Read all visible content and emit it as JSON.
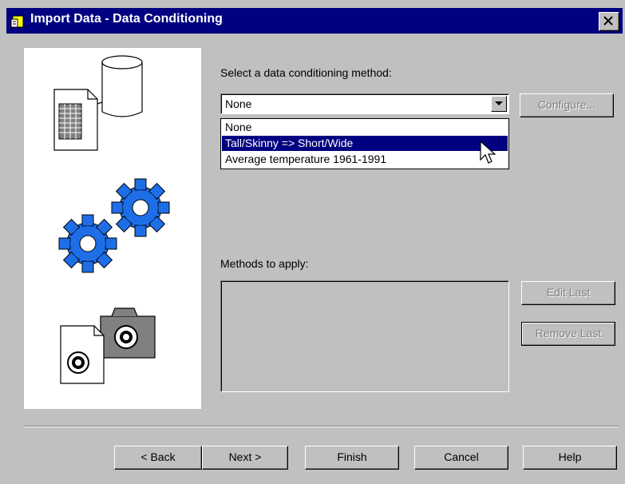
{
  "window": {
    "title": "Import Data - Data Conditioning"
  },
  "conditioning": {
    "prompt": "Select a data conditioning method:",
    "selected": "None",
    "options": [
      "None",
      "Tall/Skinny => Short/Wide",
      "Average temperature 1961-1991"
    ],
    "highlighted_index": 1,
    "configure_label": "Configure..."
  },
  "methods": {
    "label": "Methods to apply:",
    "edit_last_label": "Edit Last",
    "remove_last_label": "Remove Last"
  },
  "footer": {
    "back_label": "< Back",
    "next_label": "Next >",
    "finish_label": "Finish",
    "cancel_label": "Cancel",
    "help_label": "Help"
  },
  "icons": {
    "title": "wizard-app-icon",
    "close": "close-icon",
    "database": "database-document-icon",
    "gears": "gears-icon",
    "media": "camera-document-icon",
    "dropdown": "chevron-down-icon",
    "cursor": "mouse-pointer-icon"
  },
  "colors": {
    "title_bar": "#000080",
    "selection": "#000080",
    "gear": "#1e6ee8",
    "face": "#c0c0c0"
  }
}
